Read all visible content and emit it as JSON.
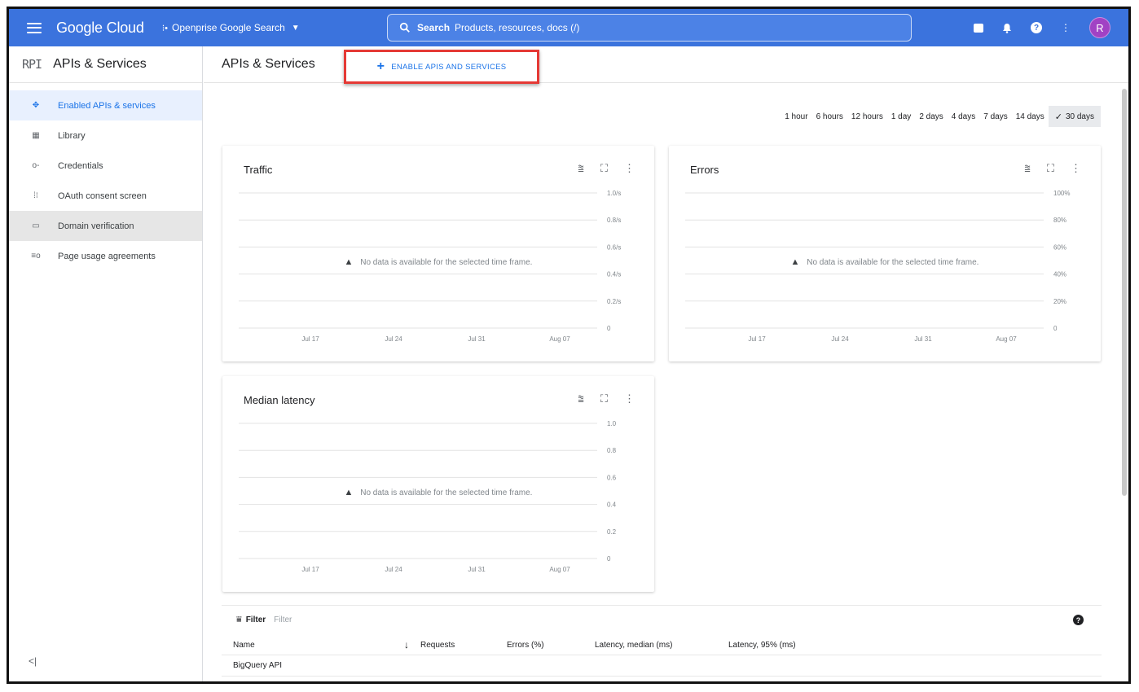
{
  "topbar": {
    "brand": "Google Cloud",
    "project_dots": "⁝•",
    "project": "Openprise Google Search",
    "search_label": "Search",
    "search_placeholder": "Products, resources, docs (/)",
    "avatar": "R",
    "icons": [
      "cloud-shell-icon",
      "bell-icon",
      "help-icon",
      "more-vert-icon"
    ]
  },
  "sidebar": {
    "logo": "RPI",
    "title": "APIs & Services",
    "items": [
      {
        "icon": "✥",
        "label": "Enabled APIs & services"
      },
      {
        "icon": "▦",
        "label": "Library"
      },
      {
        "icon": "o-",
        "label": "Credentials"
      },
      {
        "icon": "⁞⁝",
        "label": "OAuth consent screen"
      },
      {
        "icon": "▭",
        "label": "Domain verification"
      },
      {
        "icon": "≡o",
        "label": "Page usage agreements"
      }
    ],
    "collapse": "<|"
  },
  "main": {
    "title": "APIs & Services",
    "enable_plus": "+",
    "enable_button": "ENABLE APIS AND SERVICES",
    "timeframes": [
      "1 hour",
      "6 hours",
      "12 hours",
      "1 day",
      "2 days",
      "4 days",
      "7 days",
      "14 days"
    ],
    "timeframe_selected": "30 days",
    "check": "✓"
  },
  "cards": [
    {
      "title": "Traffic",
      "nodata": "No data is available for the selected time frame.",
      "warn": "▲",
      "tools": [
        "⩰",
        "⛶",
        "⋮"
      ],
      "chart_data": {
        "type": "line",
        "x_ticks": [
          "Jul 17",
          "Jul 24",
          "Jul 31",
          "Aug 07"
        ],
        "y_ticks": [
          "1.0/s",
          "0.8/s",
          "0.6/s",
          "0.4/s",
          "0.2/s",
          "0"
        ],
        "series": []
      }
    },
    {
      "title": "Errors",
      "nodata": "No data is available for the selected time frame.",
      "warn": "▲",
      "tools": [
        "⩰",
        "⛶",
        "⋮"
      ],
      "chart_data": {
        "type": "line",
        "x_ticks": [
          "Jul 17",
          "Jul 24",
          "Jul 31",
          "Aug 07"
        ],
        "y_ticks": [
          "100%",
          "80%",
          "60%",
          "40%",
          "20%",
          "0"
        ],
        "series": []
      }
    },
    {
      "title": "Median latency",
      "nodata": "No data is available for the selected time frame.",
      "warn": "▲",
      "tools": [
        "⩰",
        "⛶",
        "⋮"
      ],
      "chart_data": {
        "type": "line",
        "x_ticks": [
          "Jul 17",
          "Jul 24",
          "Jul 31",
          "Aug 07"
        ],
        "y_ticks": [
          "1.0",
          "0.8",
          "0.6",
          "0.4",
          "0.2",
          "0"
        ],
        "series": []
      }
    }
  ],
  "table": {
    "filter_icon": "⩸",
    "filter_label": "Filter",
    "filter_placeholder": "Filter",
    "help": "?",
    "sort_icon": "↓",
    "columns": [
      "Name",
      "Requests",
      "Errors (%)",
      "Latency, median (ms)",
      "Latency, 95% (ms)"
    ],
    "rows": [
      {
        "name": "BigQuery API"
      }
    ]
  }
}
